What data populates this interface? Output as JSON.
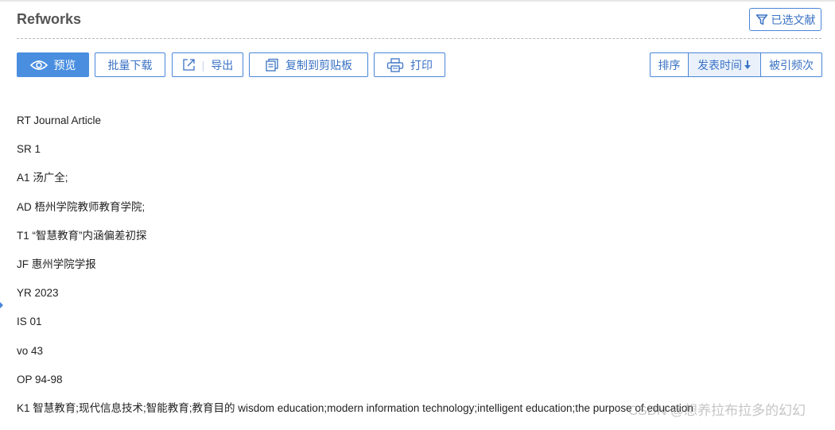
{
  "header": {
    "title": "Refworks",
    "selected_label": "已选文献"
  },
  "toolbar": {
    "preview_label": "预览",
    "batch_download_label": "批量下载",
    "export_label": "导出",
    "copy_label": "复制到剪贴板",
    "print_label": "打印"
  },
  "sort": {
    "sort_label": "排序",
    "date_label": "发表时间",
    "citations_label": "被引频次"
  },
  "records": [
    "RT Journal Article",
    "SR 1",
    "A1 汤广全;",
    "AD 梧州学院教师教育学院;",
    "T1 “智慧教育”内涵偏差初探",
    "JF 惠州学院学报",
    "YR 2023",
    "IS 01",
    "vo 43",
    "OP 94-98",
    "K1 智慧教育;现代信息技术;智能教育;教育目的 wisdom education;modern information technology;intelligent education;the purpose of education"
  ],
  "watermark": "CSDN @想养拉布拉多的幻幻",
  "colors": {
    "accent": "#4a86d8",
    "primary_fill": "#4a8ee0"
  },
  "icons": {
    "filter": "filter-icon",
    "eye": "eye-icon",
    "export": "export-icon",
    "clipboard": "clipboard-icon",
    "printer": "printer-icon",
    "sort_down": "arrow-down-icon"
  }
}
